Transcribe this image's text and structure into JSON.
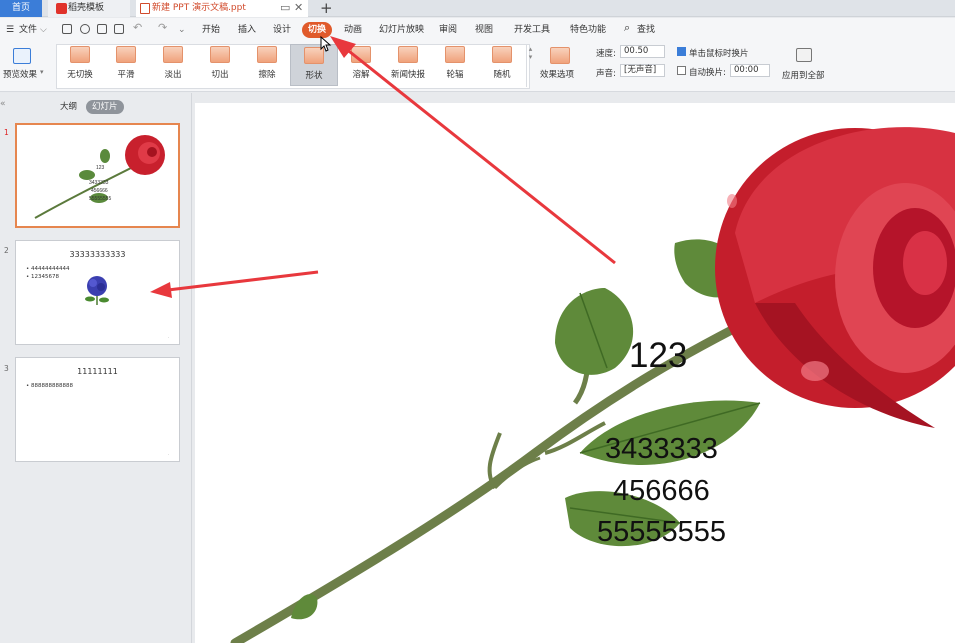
{
  "tabs": {
    "home": "首页",
    "template": "稻壳模板",
    "document": "新建 PPT 演示文稿.ppt"
  },
  "menu": {
    "file": "文件",
    "items": [
      "开始",
      "插入",
      "设计",
      "切换",
      "动画",
      "幻灯片放映",
      "审阅",
      "视图",
      "开发工具",
      "特色功能"
    ],
    "search": "查找"
  },
  "ribbon": {
    "preview": "预览效果",
    "effects": [
      "无切换",
      "平滑",
      "淡出",
      "切出",
      "擦除",
      "形状",
      "溶解",
      "新闻快报",
      "轮辐",
      "随机"
    ],
    "effect_options": "效果选项",
    "speed_label": "速度:",
    "speed_value": "00.50",
    "sound_label": "声音:",
    "sound_value": "[无声音]",
    "click_advance": "单击鼠标时换片",
    "auto_advance": "自动换片:",
    "auto_time": "00:00",
    "apply_all": "应用到全部"
  },
  "panel": {
    "outline": "大纲",
    "slides": "幻灯片"
  },
  "thumbnails": [
    {
      "number": "1",
      "texts": [
        "123",
        "3433333",
        "456666",
        "55555555"
      ]
    },
    {
      "number": "2",
      "title": "33333333333",
      "bullets": [
        "44444444444",
        "12345678"
      ]
    },
    {
      "number": "3",
      "title": "11111111",
      "bullets": [
        "888888888888"
      ]
    }
  ],
  "slide": {
    "texts": [
      "123",
      "3433333",
      "456666",
      "55555555"
    ]
  },
  "colors": {
    "accent": "#e05a2b",
    "arrow": "#e8383d",
    "home_tab": "#3b7dd8"
  }
}
